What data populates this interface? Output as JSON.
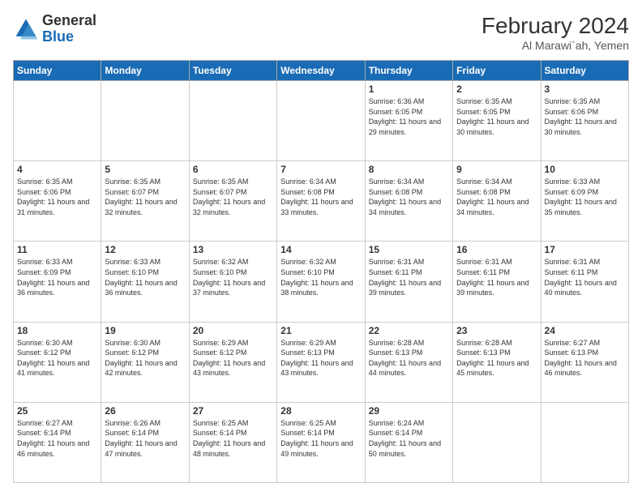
{
  "header": {
    "logo_general": "General",
    "logo_blue": "Blue",
    "month_year": "February 2024",
    "location": "Al Marawi`ah, Yemen"
  },
  "days_of_week": [
    "Sunday",
    "Monday",
    "Tuesday",
    "Wednesday",
    "Thursday",
    "Friday",
    "Saturday"
  ],
  "weeks": [
    [
      {
        "day": "",
        "info": ""
      },
      {
        "day": "",
        "info": ""
      },
      {
        "day": "",
        "info": ""
      },
      {
        "day": "",
        "info": ""
      },
      {
        "day": "1",
        "info": "Sunrise: 6:36 AM\nSunset: 6:05 PM\nDaylight: 11 hours and 29 minutes."
      },
      {
        "day": "2",
        "info": "Sunrise: 6:35 AM\nSunset: 6:05 PM\nDaylight: 11 hours and 30 minutes."
      },
      {
        "day": "3",
        "info": "Sunrise: 6:35 AM\nSunset: 6:06 PM\nDaylight: 11 hours and 30 minutes."
      }
    ],
    [
      {
        "day": "4",
        "info": "Sunrise: 6:35 AM\nSunset: 6:06 PM\nDaylight: 11 hours and 31 minutes."
      },
      {
        "day": "5",
        "info": "Sunrise: 6:35 AM\nSunset: 6:07 PM\nDaylight: 11 hours and 32 minutes."
      },
      {
        "day": "6",
        "info": "Sunrise: 6:35 AM\nSunset: 6:07 PM\nDaylight: 11 hours and 32 minutes."
      },
      {
        "day": "7",
        "info": "Sunrise: 6:34 AM\nSunset: 6:08 PM\nDaylight: 11 hours and 33 minutes."
      },
      {
        "day": "8",
        "info": "Sunrise: 6:34 AM\nSunset: 6:08 PM\nDaylight: 11 hours and 34 minutes."
      },
      {
        "day": "9",
        "info": "Sunrise: 6:34 AM\nSunset: 6:08 PM\nDaylight: 11 hours and 34 minutes."
      },
      {
        "day": "10",
        "info": "Sunrise: 6:33 AM\nSunset: 6:09 PM\nDaylight: 11 hours and 35 minutes."
      }
    ],
    [
      {
        "day": "11",
        "info": "Sunrise: 6:33 AM\nSunset: 6:09 PM\nDaylight: 11 hours and 36 minutes."
      },
      {
        "day": "12",
        "info": "Sunrise: 6:33 AM\nSunset: 6:10 PM\nDaylight: 11 hours and 36 minutes."
      },
      {
        "day": "13",
        "info": "Sunrise: 6:32 AM\nSunset: 6:10 PM\nDaylight: 11 hours and 37 minutes."
      },
      {
        "day": "14",
        "info": "Sunrise: 6:32 AM\nSunset: 6:10 PM\nDaylight: 11 hours and 38 minutes."
      },
      {
        "day": "15",
        "info": "Sunrise: 6:31 AM\nSunset: 6:11 PM\nDaylight: 11 hours and 39 minutes."
      },
      {
        "day": "16",
        "info": "Sunrise: 6:31 AM\nSunset: 6:11 PM\nDaylight: 11 hours and 39 minutes."
      },
      {
        "day": "17",
        "info": "Sunrise: 6:31 AM\nSunset: 6:11 PM\nDaylight: 11 hours and 40 minutes."
      }
    ],
    [
      {
        "day": "18",
        "info": "Sunrise: 6:30 AM\nSunset: 6:12 PM\nDaylight: 11 hours and 41 minutes."
      },
      {
        "day": "19",
        "info": "Sunrise: 6:30 AM\nSunset: 6:12 PM\nDaylight: 11 hours and 42 minutes."
      },
      {
        "day": "20",
        "info": "Sunrise: 6:29 AM\nSunset: 6:12 PM\nDaylight: 11 hours and 43 minutes."
      },
      {
        "day": "21",
        "info": "Sunrise: 6:29 AM\nSunset: 6:13 PM\nDaylight: 11 hours and 43 minutes."
      },
      {
        "day": "22",
        "info": "Sunrise: 6:28 AM\nSunset: 6:13 PM\nDaylight: 11 hours and 44 minutes."
      },
      {
        "day": "23",
        "info": "Sunrise: 6:28 AM\nSunset: 6:13 PM\nDaylight: 11 hours and 45 minutes."
      },
      {
        "day": "24",
        "info": "Sunrise: 6:27 AM\nSunset: 6:13 PM\nDaylight: 11 hours and 46 minutes."
      }
    ],
    [
      {
        "day": "25",
        "info": "Sunrise: 6:27 AM\nSunset: 6:14 PM\nDaylight: 11 hours and 46 minutes."
      },
      {
        "day": "26",
        "info": "Sunrise: 6:26 AM\nSunset: 6:14 PM\nDaylight: 11 hours and 47 minutes."
      },
      {
        "day": "27",
        "info": "Sunrise: 6:25 AM\nSunset: 6:14 PM\nDaylight: 11 hours and 48 minutes."
      },
      {
        "day": "28",
        "info": "Sunrise: 6:25 AM\nSunset: 6:14 PM\nDaylight: 11 hours and 49 minutes."
      },
      {
        "day": "29",
        "info": "Sunrise: 6:24 AM\nSunset: 6:14 PM\nDaylight: 11 hours and 50 minutes."
      },
      {
        "day": "",
        "info": ""
      },
      {
        "day": "",
        "info": ""
      }
    ]
  ]
}
